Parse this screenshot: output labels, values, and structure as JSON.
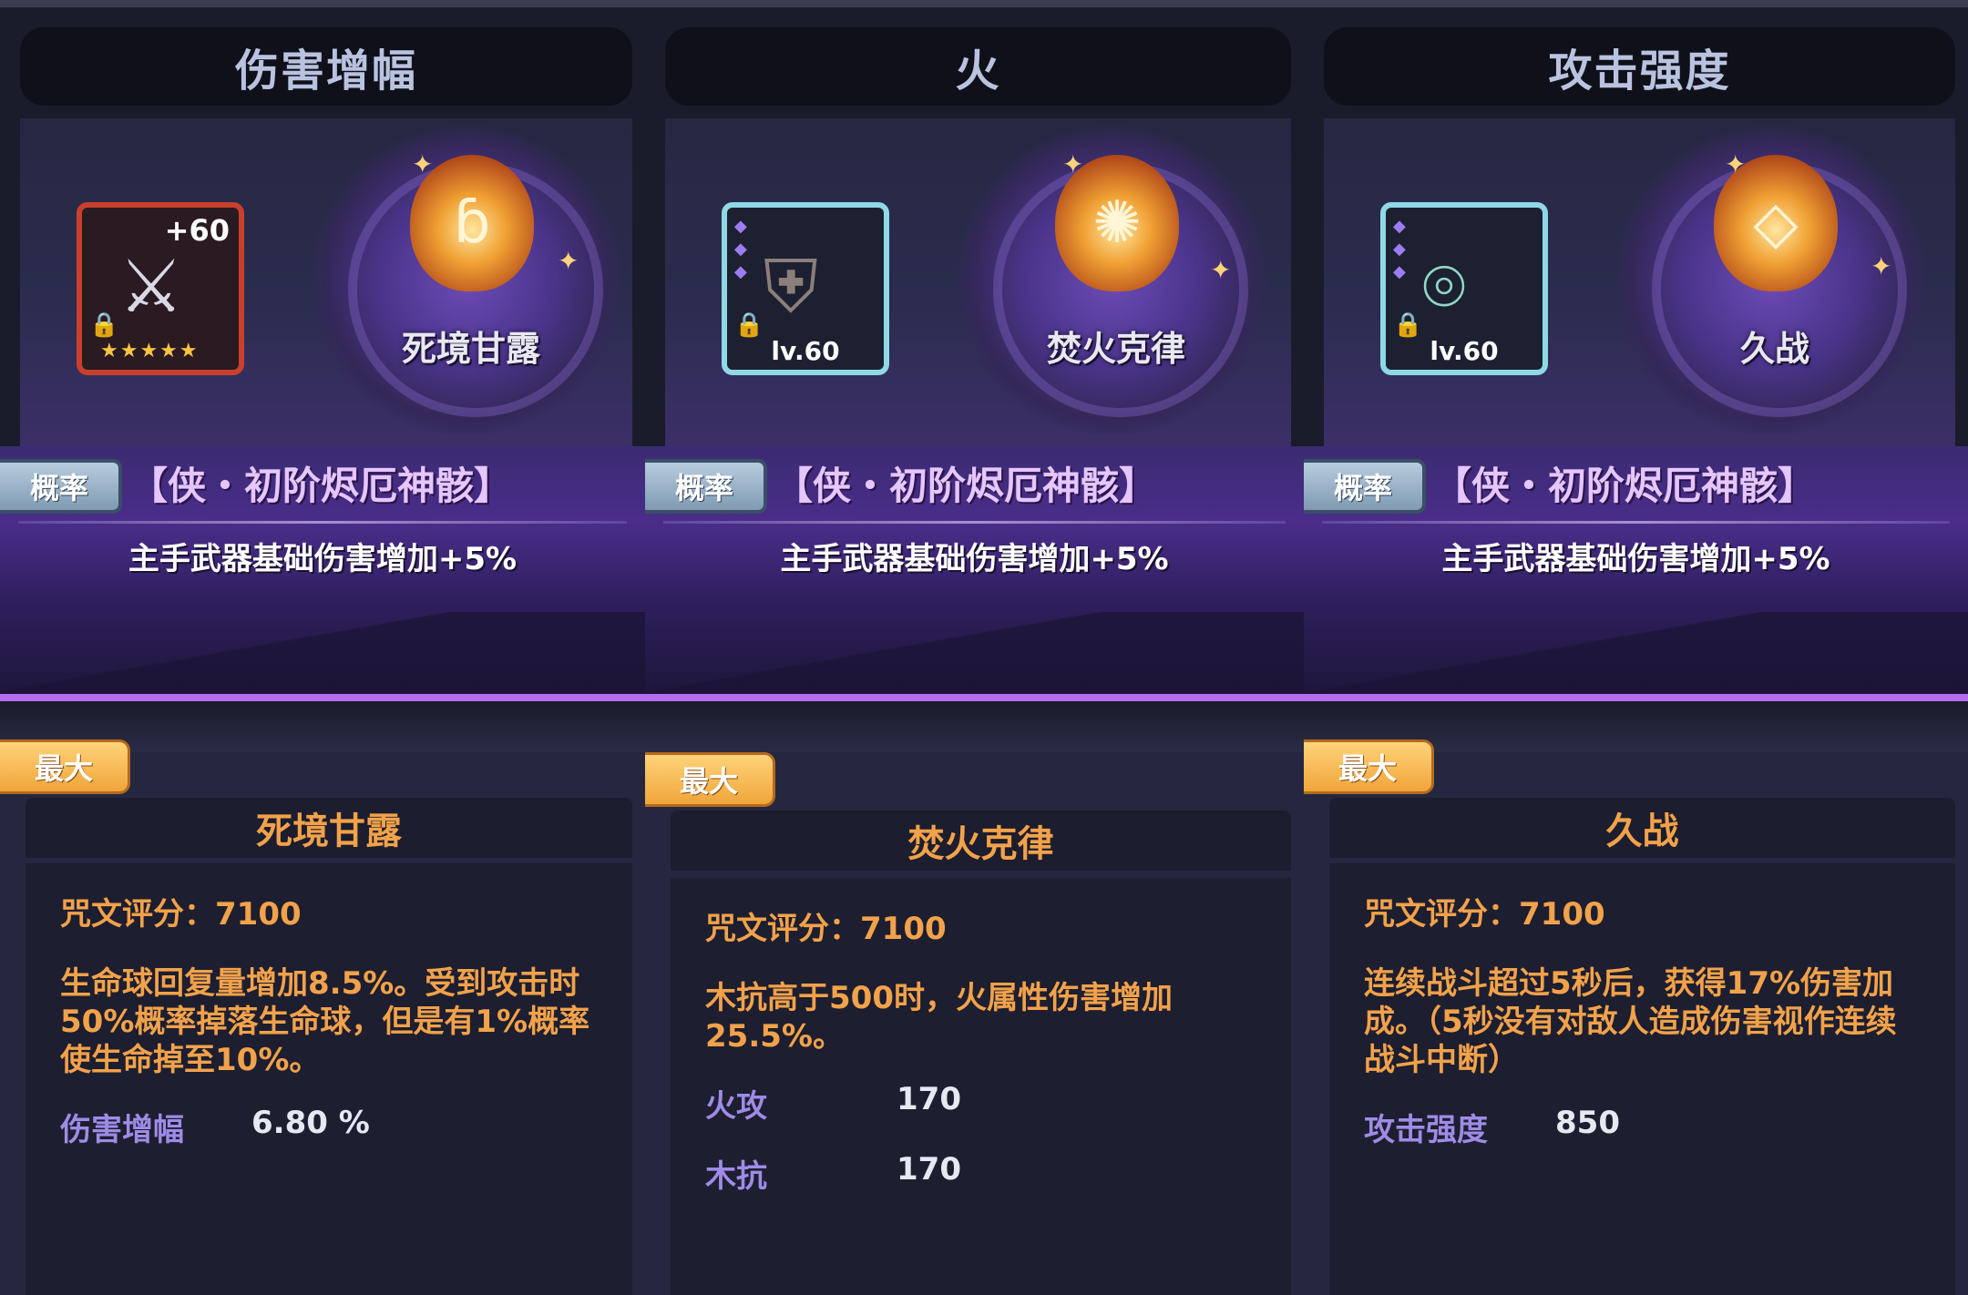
{
  "columns": [
    {
      "header": "伤害增幅",
      "equip_level": "+60",
      "equip_stars": "★★★★★",
      "rune_name": "死境甘露",
      "rate_tag": "概率",
      "set_name": "【侠・初阶烬厄神骸】",
      "set_effect": "主手武器基础伤害增加+5%",
      "max_tag": "最大",
      "detail_title": "死境甘露",
      "score": "咒文评分：7100",
      "description": "生命球回复量增加8.5%。受到攻击时50%概率掉落生命球，但是有1%概率使生命掉至10%。",
      "stats": [
        {
          "name": "伤害增幅",
          "value": "6.80 %"
        }
      ]
    },
    {
      "header": "火",
      "equip_level": "lv.60",
      "rune_name": "焚火克律",
      "rate_tag": "概率",
      "set_name": "【侠・初阶烬厄神骸】",
      "set_effect": "主手武器基础伤害增加+5%",
      "max_tag": "最大",
      "detail_title": "焚火克律",
      "score": "咒文评分：7100",
      "description": "木抗高于500时，火属性伤害增加25.5%。",
      "stats": [
        {
          "name": "火攻",
          "value": "170"
        },
        {
          "name": "木抗",
          "value": "170"
        }
      ]
    },
    {
      "header": "攻击强度",
      "equip_level": "lv.60",
      "rune_name": "久战",
      "rate_tag": "概率",
      "set_name": "【侠・初阶烬厄神骸】",
      "set_effect": "主手武器基础伤害增加+5%",
      "max_tag": "最大",
      "detail_title": "久战",
      "score": "咒文评分：7100",
      "description": "连续战斗超过5秒后，获得17%伤害加成。（5秒没有对敌人造成伤害视作连续战斗中断）",
      "stats": [
        {
          "name": "攻击强度",
          "value": "850"
        }
      ]
    }
  ],
  "icons": {
    "weapon": "sword-icon",
    "armor": "armor-icon",
    "amulet": "amulet-icon",
    "lock": "lock-icon",
    "rune": "rune-gem-icon"
  },
  "colors": {
    "accent_orange": "#f2a24a",
    "stat_purple": "#9f8be6",
    "banner_purple": "#4a2d8a",
    "frame_red": "#c8402c",
    "frame_cyan": "#8fd8e6"
  }
}
